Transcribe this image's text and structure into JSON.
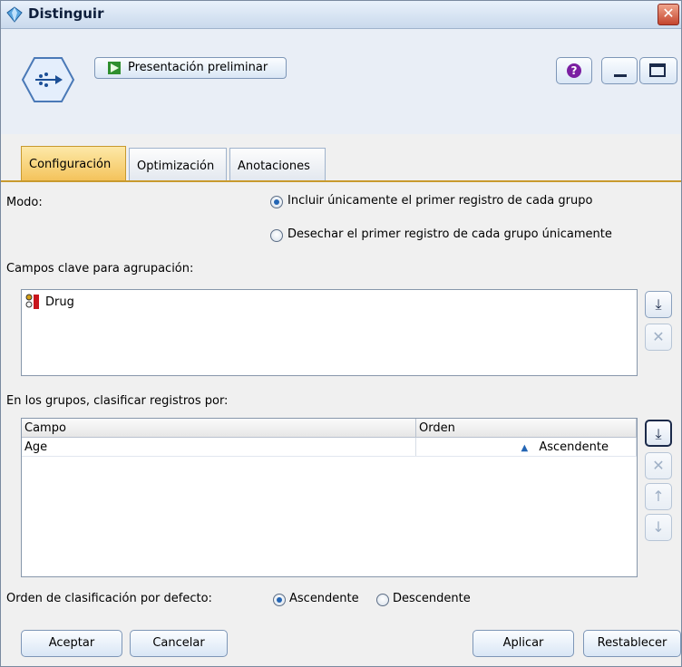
{
  "window": {
    "title": "Distinguir"
  },
  "toolbar": {
    "preview_label": "Presentación preliminar"
  },
  "tabs": [
    {
      "label": "Configuración",
      "active": true
    },
    {
      "label": "Optimización",
      "active": false
    },
    {
      "label": "Anotaciones",
      "active": false
    }
  ],
  "mode": {
    "label": "Modo:",
    "options": [
      {
        "label": "Incluir únicamente el primer registro de cada grupo",
        "selected": true
      },
      {
        "label": "Desechar el primer registro de cada grupo únicamente",
        "selected": false
      }
    ]
  },
  "key_fields": {
    "label": "Campos clave para agrupación:",
    "items": [
      "Drug"
    ]
  },
  "sort_records": {
    "label": "En los grupos, clasificar registros por:",
    "columns": [
      "Campo",
      "Orden"
    ],
    "rows": [
      {
        "field": "Age",
        "order": "Ascendente"
      }
    ]
  },
  "default_sort": {
    "label": "Orden de clasificación por defecto:",
    "options": [
      {
        "label": "Ascendente",
        "selected": true
      },
      {
        "label": "Descendente",
        "selected": false
      }
    ]
  },
  "buttons": {
    "ok": "Aceptar",
    "cancel": "Cancelar",
    "apply": "Aplicar",
    "reset": "Restablecer"
  },
  "colors": {
    "active_tab": "#f4c35c",
    "accent": "#2465b4"
  }
}
